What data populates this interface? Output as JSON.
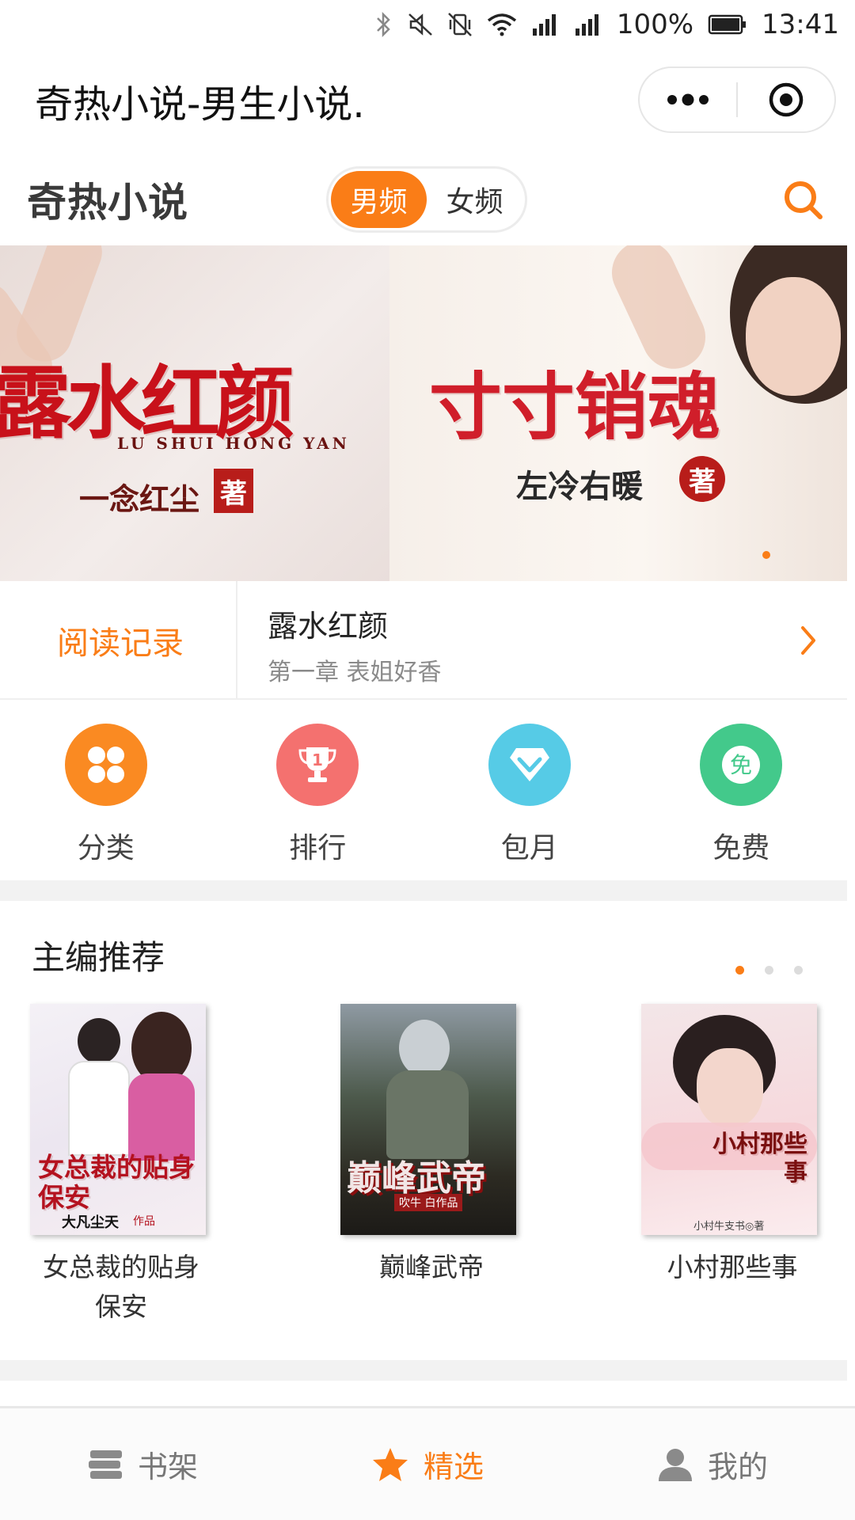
{
  "status_bar": {
    "battery": "100%",
    "time": "13:41"
  },
  "title_bar": {
    "title": "奇热小说-男生小说."
  },
  "header": {
    "logo": "奇热小说",
    "gender_tabs": [
      {
        "label": "男频",
        "active": true
      },
      {
        "label": "女频",
        "active": false
      }
    ]
  },
  "banner": {
    "left": {
      "title": "露水红颜",
      "subtitle": "LU SHUI HONG YAN",
      "author": "一念红尘",
      "seal": "著"
    },
    "right": {
      "title": "寸寸销魂",
      "author": "左冷右暖",
      "seal": "著"
    }
  },
  "reading_record": {
    "label": "阅读记录",
    "book": "露水红颜",
    "chapter": "第一章 表姐好香"
  },
  "quick_nav": [
    {
      "label": "分类",
      "icon": "grid-clover-icon",
      "color": "#fa8a22"
    },
    {
      "label": "排行",
      "icon": "trophy-icon",
      "color": "#f4716f",
      "badge": "1"
    },
    {
      "label": "包月",
      "icon": "diamond-icon",
      "color": "#56cbe6"
    },
    {
      "label": "免费",
      "icon": "free-badge-icon",
      "color": "#43c98b",
      "badge": "免"
    }
  ],
  "recommend": {
    "title": "主编推荐",
    "books": [
      {
        "name": "女总裁的贴身保安",
        "cover_title": "女总裁的贴身保安",
        "cover_author": "大凡尘天",
        "cover_note": "作品"
      },
      {
        "name": "巅峰武帝",
        "cover_title": "巅峰武帝",
        "cover_author": "吹牛 白作品"
      },
      {
        "name": "小村那些事",
        "cover_title": "小村那些事",
        "cover_author": "小村牛支书◎著"
      }
    ]
  },
  "tab_bar": [
    {
      "label": "书架",
      "icon": "bookshelf-icon",
      "active": false
    },
    {
      "label": "精选",
      "icon": "star-icon",
      "active": true
    },
    {
      "label": "我的",
      "icon": "user-icon",
      "active": false
    }
  ],
  "colors": {
    "accent": "#fa7d17"
  }
}
